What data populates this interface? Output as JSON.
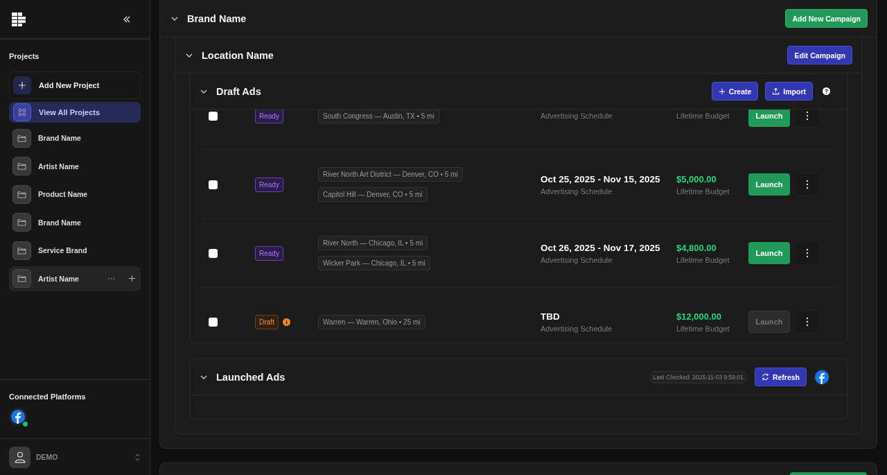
{
  "sidebar": {
    "projects_heading": "Projects",
    "actions": [
      {
        "kind": "add",
        "label": "Add New Project",
        "selected": false
      },
      {
        "kind": "all",
        "label": "View All Projects",
        "selected": true
      }
    ],
    "projects": [
      {
        "name": "Brand Name",
        "hovered": false
      },
      {
        "name": "Artist Name",
        "hovered": false
      },
      {
        "name": "Product Name",
        "hovered": false
      },
      {
        "name": "Brand Name",
        "hovered": false
      },
      {
        "name": "Service Brand",
        "hovered": false
      },
      {
        "name": "Artist Name",
        "hovered": true
      }
    ],
    "platforms_heading": "Connected Platforms",
    "platforms": [
      {
        "kind": "facebook",
        "connected": true
      }
    ],
    "user": {
      "name": "DEMO"
    }
  },
  "campaign": {
    "title": "Brand Name",
    "expanded": true,
    "button": "Add New Campaign",
    "location": {
      "title": "Location Name",
      "expanded": true,
      "button": "Edit Campaign",
      "draft_ads": {
        "title": "Draft Ads",
        "expanded": true,
        "create": "Create",
        "import": "Import",
        "rows": [
          {
            "checked": false,
            "status": {
              "kind": "ready",
              "label": "Ready"
            },
            "info": false,
            "locations": [
              "South Congress — Austin, TX • 5 mi"
            ],
            "schedule_label": "Advertising Schedule",
            "budget_label": "Lifetime Budget",
            "launch": "Launch",
            "launch_disabled": false
          },
          {
            "checked": false,
            "status": {
              "kind": "ready",
              "label": "Ready"
            },
            "info": false,
            "locations": [
              "River North Art District — Denver, CO • 5 mi",
              "Capitol Hill — Denver, CO • 5 mi"
            ],
            "date": "Oct 25, 2025 - Nov 15, 2025",
            "schedule_label": "Advertising Schedule",
            "budget": "$5,000.00",
            "budget_label": "Lifetime Budget",
            "launch": "Launch",
            "launch_disabled": false
          },
          {
            "checked": false,
            "status": {
              "kind": "ready",
              "label": "Ready"
            },
            "info": false,
            "locations": [
              "River North — Chicago, IL • 5 mi",
              "Wicker Park — Chicago, IL • 5 mi"
            ],
            "date": "Oct 26, 2025 - Nov 17, 2025",
            "schedule_label": "Advertising Schedule",
            "budget": "$4,800.00",
            "budget_label": "Lifetime Budget",
            "launch": "Launch",
            "launch_disabled": false
          },
          {
            "checked": false,
            "status": {
              "kind": "draft",
              "label": "Draft"
            },
            "info": true,
            "locations": [
              "Warren — Warren, Ohio • 25 mi"
            ],
            "date": "TBD",
            "schedule_label": "Advertising Schedule",
            "budget": "$12,000.00",
            "budget_label": "Lifetime Budget",
            "launch": "Launch",
            "launch_disabled": true
          }
        ]
      },
      "launched_ads": {
        "title": "Launched Ads",
        "expanded": true,
        "last_checked": "Last Checked: 2025-11-03 9:59:01",
        "refresh": "Refresh"
      }
    }
  }
}
